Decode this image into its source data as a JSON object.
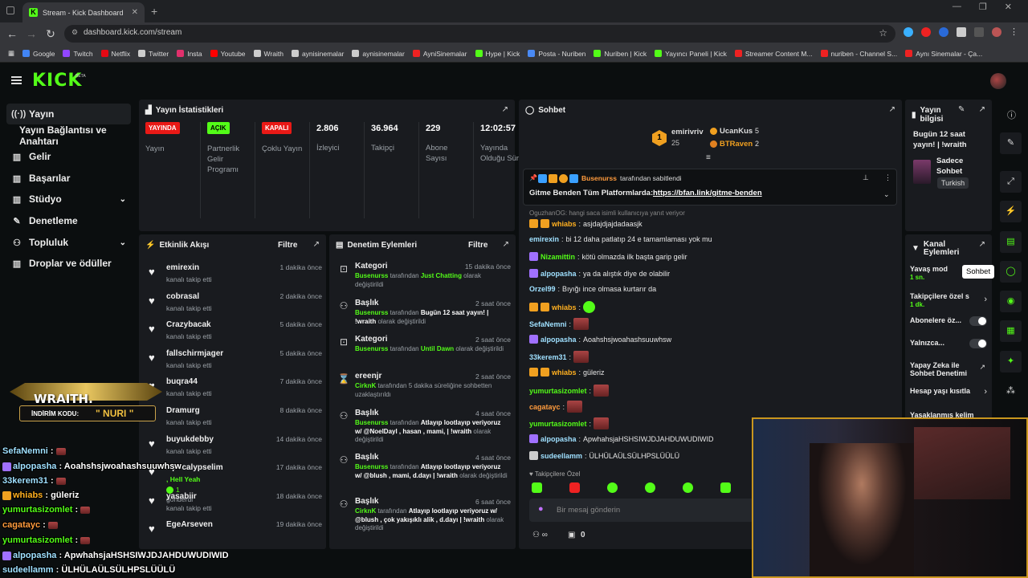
{
  "browser": {
    "tab_title": "Stream - Kick Dashboard",
    "url": "dashboard.kick.com/stream"
  },
  "bookmarks": [
    "Google",
    "Twitch",
    "Netflix",
    "Twitter",
    "Insta",
    "Youtube",
    "Wraith",
    "aynisinemalar",
    "aynisinemalar",
    "AyniSinemalar",
    "Hype | Kick",
    "Posta - Nuriben",
    "Nuriben | Kick",
    "Yayıncı Paneli | Kick",
    "Streamer Content M...",
    "nuriben - Channel S...",
    "Aynı Sinemalar - Ça..."
  ],
  "brand": {
    "logo": "KICK",
    "beta": "BETA",
    "accent": "#53fc18"
  },
  "sidebar": {
    "items": [
      {
        "label": "Yayın",
        "icon": "broadcast-icon"
      },
      {
        "label": "Yayın Bağlantısı ve Anahtarı"
      },
      {
        "label": "Gelir",
        "icon": "money-icon"
      },
      {
        "label": "Başarılar",
        "icon": "trophy-icon"
      },
      {
        "label": "Stüdyo",
        "icon": "studio-icon"
      },
      {
        "label": "Denetleme",
        "icon": "wrench-icon"
      },
      {
        "label": "Topluluk",
        "icon": "users-icon"
      },
      {
        "label": "Droplar ve ödüller",
        "icon": "gift-icon"
      }
    ]
  },
  "stats": {
    "title": "Yayın İstatistikleri",
    "items": [
      {
        "badge": "YAYINDA",
        "label": "Yayın"
      },
      {
        "badge": "AÇIK",
        "label": "Partnerlik Gelir Programı"
      },
      {
        "badge": "KAPALI",
        "label": "Çoklu Yayın"
      },
      {
        "value": "2.806",
        "label": "İzleyici"
      },
      {
        "value": "36.964",
        "label": "Takipçi"
      },
      {
        "value": "229",
        "label": "Abone Sayısı"
      },
      {
        "value": "12:02:57",
        "label": "Yayında Olduğu Süre"
      }
    ]
  },
  "activity": {
    "title": "Etkinlik Akışı",
    "filter": "Filtre",
    "items": [
      {
        "name": "emirexin",
        "sub": "kanalı takip etti",
        "time": "1 dakika önce"
      },
      {
        "name": "cobrasal",
        "sub": "kanalı takip etti",
        "time": "2 dakika önce"
      },
      {
        "name": "Crazybacak",
        "sub": "kanalı takip etti",
        "time": "5 dakika önce"
      },
      {
        "name": "fallschirmjager",
        "sub": "kanalı takip etti",
        "time": "5 dakika önce"
      },
      {
        "name": "buqra44",
        "sub": "kanalı takip etti",
        "time": "7 dakika önce"
      },
      {
        "name": "Dramurg",
        "sub": "kanalı takip etti",
        "time": "8 dakika önce"
      },
      {
        "name": "buyukdebby",
        "sub": "kanalı takip etti",
        "time": "14 dakika önce"
      },
      {
        "name": "Apocalypselim",
        "sub": ", Hell Yeah",
        "extra": "1",
        "extra2": "gönderdi",
        "time": "17 dakika önce"
      },
      {
        "name": "yasabiir",
        "sub": "kanalı takip etti",
        "time": "18 dakika önce"
      },
      {
        "name": "EgeArseven",
        "sub": "",
        "time": "19 dakika önce"
      }
    ]
  },
  "moderation": {
    "title": "Denetim Eylemleri",
    "filter": "Filtre",
    "items": [
      {
        "title": "Kategori",
        "time": "15 dakika önce",
        "user": "Busenurss",
        "mid": " tarafından ",
        "val": "Just Chatting",
        "tail": " olarak değiştirildi"
      },
      {
        "title": "Başlık",
        "time": "2 saat önce",
        "user": "Busenurss",
        "mid": " tarafından ",
        "val": "Bugün 12 saat yayın! | !wraith",
        "tail": " olarak değiştirildi"
      },
      {
        "title": "Kategori",
        "time": "2 saat önce",
        "user": "Busenurss",
        "mid": " tarafından ",
        "val": "Until Dawn",
        "tail": " olarak değiştirildi"
      },
      {
        "title": "ereenjr",
        "time": "2 saat önce",
        "user": "CirknK",
        "mid": " tarafından 5 dakika süreliğine sohbetten uzaklaştırıldı",
        "val": "",
        "tail": ""
      },
      {
        "title": "Başlık",
        "time": "4 saat önce",
        "user": "Busenurss",
        "mid": " tarafından ",
        "val": "Atlayıp lootlayıp veriyoruz w/ @NoelDayl , hasan , mami, | !wraith",
        "tail": " olarak değiştirildi"
      },
      {
        "title": "Başlık",
        "time": "4 saat önce",
        "user": "Busenurss",
        "mid": " tarafından ",
        "val": "Atlayıp lootlayıp veriyoruz w/ @blush , mami, d.dayı | !wraith",
        "tail": " olarak değiştirildi"
      },
      {
        "title": "Başlık",
        "time": "6 saat önce",
        "user": "CirknK",
        "mid": " tarafından ",
        "val": "Atlayıp lootlayıp veriyoruz w/ @blush , çok yakışıklı alik , d.dayı | !wraith",
        "tail": " olarak değiştirildi"
      }
    ]
  },
  "chat": {
    "title": "Sohbet",
    "top": [
      {
        "name": "emirivriv",
        "value": "25"
      },
      {
        "name": "UcanKus",
        "value": "5"
      },
      {
        "name": "BTRaven",
        "value": "2"
      }
    ],
    "pinned": {
      "by": "Busenurss",
      "by_suffix": "tarafından sabitlendi",
      "text": "Gitme Benden Tüm Platformlarda:",
      "link": "https://bfan.link/gitme-benden"
    },
    "reply_hint": "OguzhanOG: hangi saca isimli kullanıcıya yanıt veriyor",
    "messages": [
      {
        "user": "whiabs",
        "text": "asjdajdjajdadaasjk",
        "color": "#ffb020"
      },
      {
        "user": "emirexin",
        "text": "bi 12 daha patlatıp 24 e tamamlaması yok mu",
        "color": "#9fe0ff"
      },
      {
        "user": "Nizamittin",
        "text": "kötü olmazda ilk başta garip gelir",
        "color": "#53fc18"
      },
      {
        "user": "alpopasha",
        "text": "ya da alıştık diye de olabilir",
        "color": "#9fe0ff"
      },
      {
        "user": "Orzel99",
        "text": "Bıyığı ince olmasa kurtarır da",
        "color": "#9fe0ff"
      },
      {
        "user": "whiabs",
        "text": "",
        "color": "#ffb020"
      },
      {
        "user": "SefaNemni",
        "text": "",
        "color": "#9fe0ff"
      },
      {
        "user": "alpopasha",
        "text": "Aoahshsjwoahashsuuwhsw",
        "color": "#9fe0ff"
      },
      {
        "user": "33kerem31",
        "text": "",
        "color": "#9fe0ff"
      },
      {
        "user": "whiabs",
        "text": "güleriz",
        "color": "#ffb020"
      },
      {
        "user": "yumurtasizomlet",
        "text": "",
        "color": "#53fc18"
      },
      {
        "user": "cagatayc",
        "text": "",
        "color": "#ff9b3d"
      },
      {
        "user": "yumurtasizomlet",
        "text": "",
        "color": "#53fc18"
      },
      {
        "user": "alpopasha",
        "text": "ApwhahsjaHSHSIWJDJAHDUWUDIWID",
        "color": "#9fe0ff"
      },
      {
        "user": "sudeellamm",
        "text": "ÜLHÜLAÜLSÜLHPSLÜÜLÜ",
        "color": "#9fe0ff"
      }
    ],
    "followers_only": "Takipçilere Özel",
    "input_placeholder": "Bir mesaj gönderin",
    "count": "0"
  },
  "stream_info": {
    "title": "Yayın bilgisi",
    "desc": "Bugün 12 saat yayın! | !wraith",
    "category": "Sadece Sohbet",
    "language": "Turkish"
  },
  "channel_actions": {
    "title": "Kanal Eylemleri",
    "items": [
      {
        "label": "Yavaş mod",
        "sub": "1 sn."
      },
      {
        "label": "Takipçilere özel s",
        "sub": "1 dk."
      },
      {
        "label": "Abonelere öz..."
      },
      {
        "label": "Yalnızca..."
      },
      {
        "label": "Yapay Zeka ile Sohbet Denetimi"
      },
      {
        "label": "Hesap yaşı kısıtla"
      },
      {
        "label": "Yasaklanmış kelim"
      }
    ]
  },
  "tooltip": "Sohbet",
  "overlay": {
    "promo_brand": "WRAITH.",
    "promo_text": "İNDİRİM KODU:",
    "promo_code": "\" NURI \"",
    "chat": [
      {
        "user": "SefaNemni",
        "text": ""
      },
      {
        "user": "alpopasha",
        "text": "Aoahshsjwoahashsuuwhsw"
      },
      {
        "user": "33kerem31",
        "text": ""
      },
      {
        "user": "whiabs",
        "text": "güleriz"
      },
      {
        "user": "yumurtasizomlet",
        "text": ""
      },
      {
        "user": "cagatayc",
        "text": ""
      },
      {
        "user": "yumurtasizomlet",
        "text": ""
      },
      {
        "user": "alpopasha",
        "text": "ApwhahsjaHSHSIWJDJAHDUWUDIWID"
      },
      {
        "user": "sudeellamm",
        "text": "ÜLHÜLAÜLSÜLHPSLÜÜLÜ"
      }
    ]
  }
}
